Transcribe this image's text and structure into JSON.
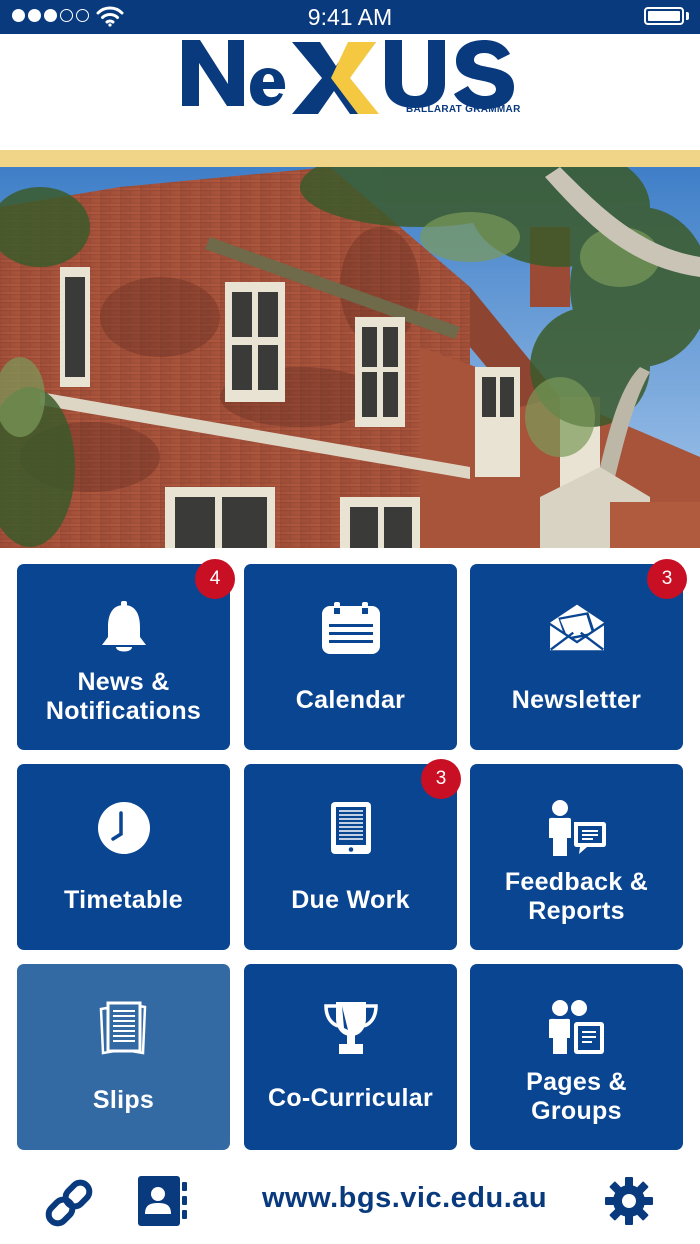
{
  "status_bar": {
    "time": "9:41 AM",
    "signal_icon": "signal-dots-icon",
    "wifi_icon": "wifi-icon",
    "battery_icon": "battery-icon"
  },
  "header": {
    "logo_text": "NeXUS",
    "logo_subtitle": "BALLARAT GRAMMAR",
    "colors": {
      "brand_blue": "#0a3a7e",
      "gold": "#f0d488",
      "x_yellow": "#f5c842"
    }
  },
  "hero": {
    "image": "school-building-photo"
  },
  "tiles": [
    {
      "label": "News & Notifications",
      "icon": "bell-icon",
      "badge": "4"
    },
    {
      "label": "Calendar",
      "icon": "calendar-icon",
      "badge": ""
    },
    {
      "label": "Newsletter",
      "icon": "envelope-icon",
      "badge": "3"
    },
    {
      "label": "Timetable",
      "icon": "clock-icon",
      "badge": ""
    },
    {
      "label": "Due Work",
      "icon": "tablet-icon",
      "badge": "3"
    },
    {
      "label": "Feedback & Reports",
      "icon": "feedback-icon",
      "badge": ""
    },
    {
      "label": "Slips",
      "icon": "slips-icon",
      "badge": ""
    },
    {
      "label": "Co-Curricular",
      "icon": "trophy-icon",
      "badge": ""
    },
    {
      "label": "Pages & Groups",
      "icon": "groups-icon",
      "badge": ""
    }
  ],
  "footer": {
    "url": "www.bgs.vic.edu.au",
    "link_icon": "link-icon",
    "contacts_icon": "contacts-icon",
    "settings_icon": "gear-icon"
  }
}
